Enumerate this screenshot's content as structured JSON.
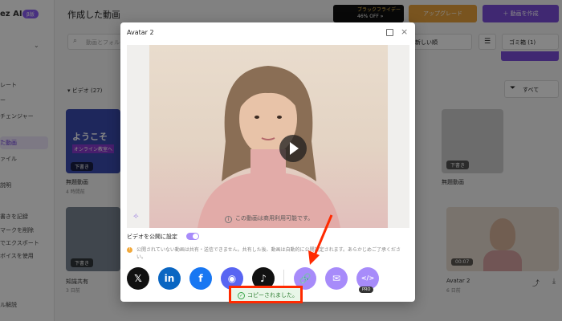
{
  "app": {
    "logo": "ez AI",
    "logo_badge": "β版",
    "page_title": "作成した動画",
    "promo_line1": "ブラックフライデー",
    "promo_line2": "46% OFF »",
    "upgrade_label": "アップグレード",
    "create_label": "＋ 動画を作成",
    "search_placeholder": "動画とフォルダを検索",
    "sort_label": "新しい順",
    "trash_label": "ゴミ箱 (1)",
    "section_label": "▾ ビデオ (27)",
    "filter_label": "すべて"
  },
  "sidebar": {
    "items": [
      "レート",
      "ー",
      "チェンジャー",
      "た動画",
      "ァイル",
      "説明",
      "書きを記録",
      "マークを削除",
      "でエクスポート",
      "ボイスを使用",
      "ル解説"
    ]
  },
  "cards": [
    {
      "title": "無題動画",
      "sub": "4 時間前",
      "tag": "下書き",
      "banner": "ようこそ",
      "banner_sub": "オンライン教室へ"
    },
    {
      "title": "無題動画",
      "sub": "",
      "tag": "下書き"
    },
    {
      "title": "知識共有",
      "sub": "3 日前",
      "tag": "下書き"
    },
    {
      "title": "Avatar 2",
      "sub": "6 日前",
      "tag": "00:07"
    }
  ],
  "modal": {
    "title": "Avatar 2",
    "notice": "この動画は商用利用可能です。",
    "public_label": "ビデオを公開に設定",
    "warning": "公開されていない動画は共有・送信できません。共有した後、動画は自動的に公開設定されます。あらかじめご了承ください。",
    "share_buttons": [
      {
        "name": "x-share-button",
        "glyph": "𝕏",
        "color": "#111111"
      },
      {
        "name": "linkedin-share-button",
        "glyph": "in",
        "color": "#0a66c2"
      },
      {
        "name": "facebook-share-button",
        "glyph": "f",
        "color": "#1877f2"
      },
      {
        "name": "discord-share-button",
        "glyph": "◉",
        "color": "#5865f2"
      },
      {
        "name": "tiktok-share-button",
        "glyph": "♪",
        "color": "#111111"
      },
      {
        "name": "copy-link-button",
        "glyph": "🔗",
        "color": "#a78bfa"
      },
      {
        "name": "email-share-button",
        "glyph": "✉",
        "color": "#a78bfa"
      },
      {
        "name": "embed-code-button",
        "glyph": "</>",
        "color": "#a78bfa"
      }
    ],
    "pro_badge": "PRO"
  },
  "toast": {
    "text": "コピーされました。"
  }
}
